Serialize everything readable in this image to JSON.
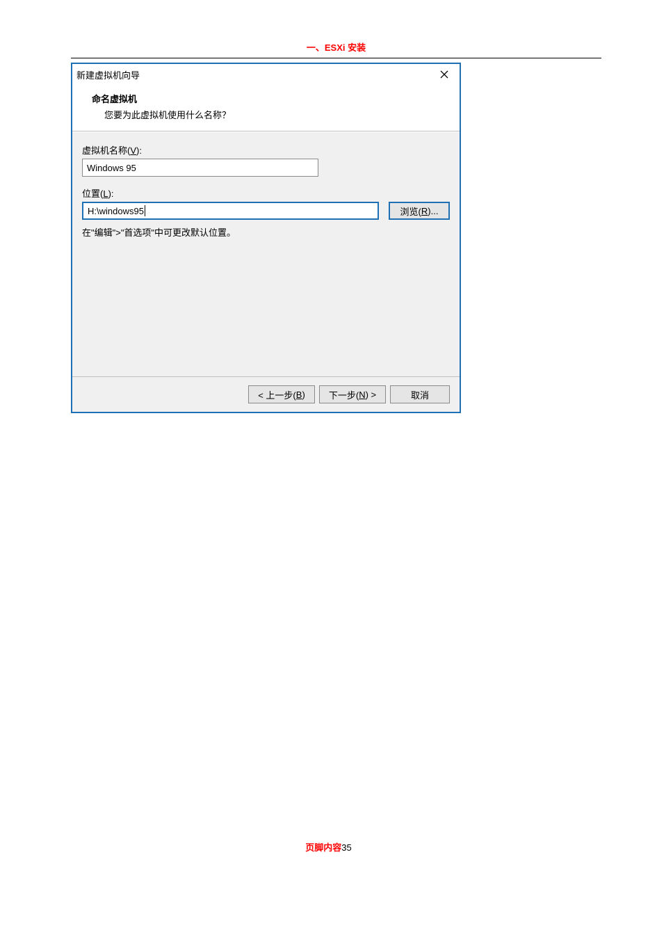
{
  "page": {
    "header_text": "一、ESXi 安装",
    "footer_label": "页脚内容",
    "footer_page": "35"
  },
  "dialog": {
    "window_title": "新建虚拟机向导",
    "close_icon_name": "close-icon",
    "header": {
      "title": "命名虚拟机",
      "subtitle": "您要为此虚拟机使用什么名称？"
    },
    "name_field": {
      "label_pre": "虚拟机名称(",
      "label_key": "V",
      "label_post": "):",
      "value": "Windows 95"
    },
    "location_field": {
      "label_pre": "位置(",
      "label_key": "L",
      "label_post": "):",
      "value": "H:\\windows95"
    },
    "browse_button": {
      "pre": "浏览(",
      "key": "R",
      "post": ")..."
    },
    "hint_text": "在\"编辑\">\"首选项\"中可更改默认位置。",
    "buttons": {
      "back": {
        "pre": "< 上一步(",
        "key": "B",
        "post": ")"
      },
      "next": {
        "pre": "下一步(",
        "key": "N",
        "post": ") >"
      },
      "cancel": "取消"
    }
  }
}
